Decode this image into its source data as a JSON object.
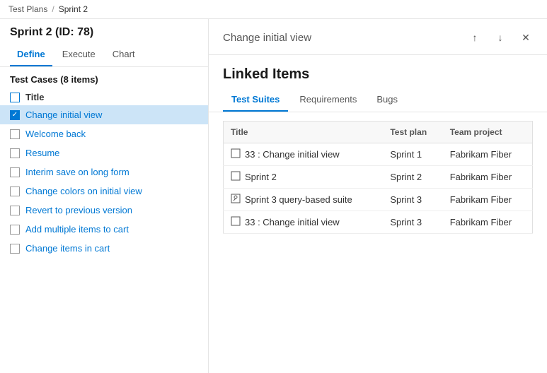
{
  "breadcrumb": {
    "part1": "Test Plans",
    "sep": "/",
    "part2": "Sprint 2"
  },
  "left": {
    "sprint_title": "Sprint 2 (ID: 78)",
    "tabs": [
      {
        "label": "Define",
        "active": true
      },
      {
        "label": "Execute",
        "active": false
      },
      {
        "label": "Chart",
        "active": false
      }
    ],
    "test_cases_header": "Test Cases (8 items)",
    "items": [
      {
        "label": "Title",
        "type": "header",
        "checked": "minus"
      },
      {
        "label": "Change initial view",
        "type": "checked",
        "selected": true
      },
      {
        "label": "Welcome back",
        "type": "unchecked"
      },
      {
        "label": "Resume",
        "type": "unchecked"
      },
      {
        "label": "Interim save on long form",
        "type": "unchecked"
      },
      {
        "label": "Change colors on initial view",
        "type": "unchecked"
      },
      {
        "label": "Revert to previous version",
        "type": "unchecked"
      },
      {
        "label": "Add multiple items to cart",
        "type": "unchecked"
      },
      {
        "label": "Change items in cart",
        "type": "unchecked"
      }
    ]
  },
  "right": {
    "panel_title": "Change initial view",
    "linked_items_title": "Linked Items",
    "up_icon": "↑",
    "down_icon": "↓",
    "close_icon": "✕",
    "tabs": [
      {
        "label": "Test Suites",
        "active": true
      },
      {
        "label": "Requirements",
        "active": false
      },
      {
        "label": "Bugs",
        "active": false
      }
    ],
    "table": {
      "columns": [
        "Title",
        "Test plan",
        "Team project"
      ],
      "rows": [
        {
          "icon": "static",
          "title": "33 : Change initial view",
          "test_plan": "Sprint 1",
          "team_project": "Fabrikam Fiber"
        },
        {
          "icon": "static",
          "title": "Sprint 2",
          "test_plan": "Sprint 2",
          "team_project": "Fabrikam Fiber"
        },
        {
          "icon": "query",
          "title": "Sprint 3 query-based suite",
          "test_plan": "Sprint 3",
          "team_project": "Fabrikam Fiber"
        },
        {
          "icon": "static",
          "title": "33 : Change initial view",
          "test_plan": "Sprint 3",
          "team_project": "Fabrikam Fiber"
        }
      ]
    }
  }
}
